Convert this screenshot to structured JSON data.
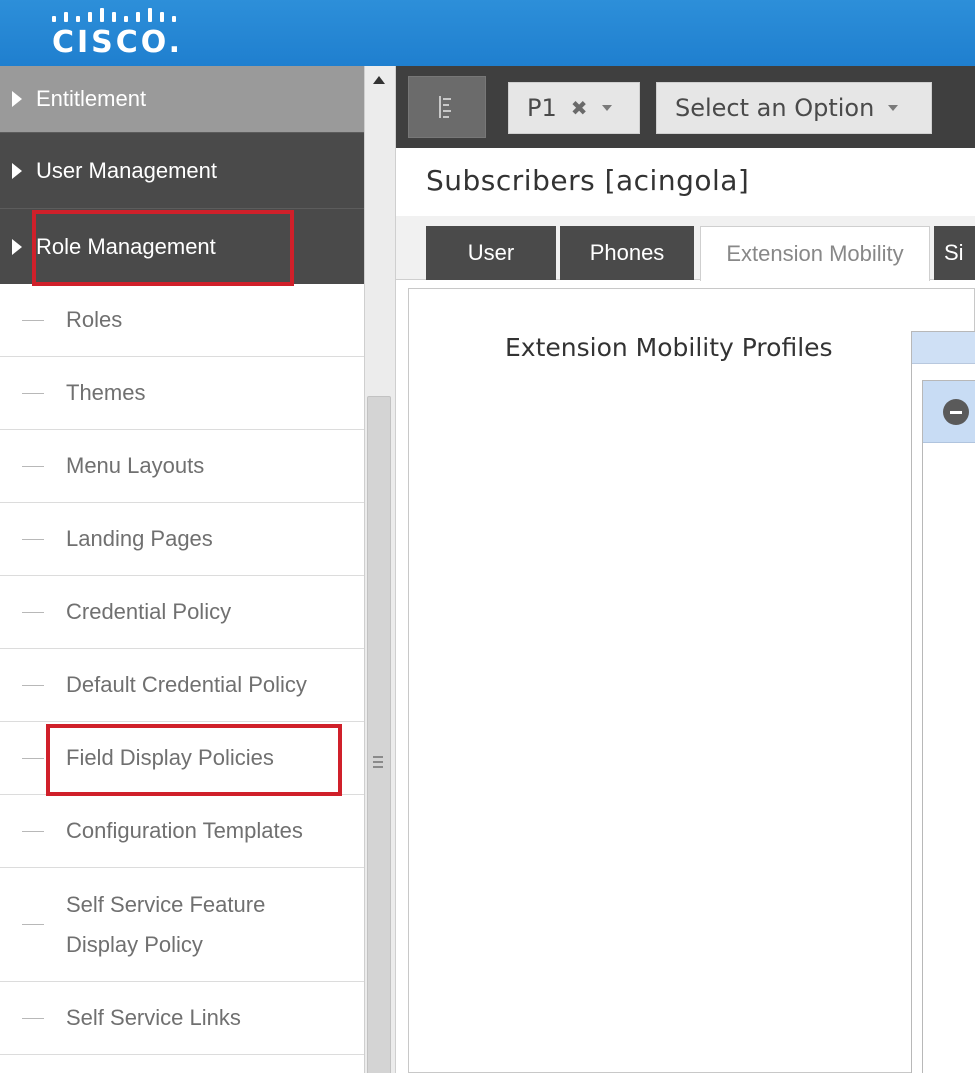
{
  "brand": {
    "logo_text": "CISCO",
    "logo_dot": ".",
    "color": "#1f7fcf"
  },
  "sidebar": {
    "top_items": [
      {
        "label": "Entitlement"
      },
      {
        "label": "User Management"
      },
      {
        "label": "Role Management"
      }
    ],
    "sub_items": [
      {
        "label": "Roles"
      },
      {
        "label": "Themes"
      },
      {
        "label": "Menu Layouts"
      },
      {
        "label": "Landing Pages"
      },
      {
        "label": "Credential Policy"
      },
      {
        "label": "Default Credential Policy"
      },
      {
        "label": "Field Display Policies"
      },
      {
        "label": "Configuration Templates"
      },
      {
        "label": "Self Service Feature Display Policy"
      },
      {
        "label": "Self Service Links"
      }
    ],
    "highlight_color": "#d0202a"
  },
  "toolbar": {
    "toggle_icon": "sidebar-toggle-icon",
    "hierarchy_select": {
      "value": "P1",
      "clear_icon": "close-icon"
    },
    "option_select": {
      "value": "Select an Option"
    }
  },
  "page": {
    "title": "Subscribers [acingola]"
  },
  "tabs": [
    {
      "label": "User"
    },
    {
      "label": "Phones"
    },
    {
      "label": "Extension Mobility"
    },
    {
      "label": "Si"
    }
  ],
  "content": {
    "profiles_label": "Extension Mobility Profiles",
    "remove_icon": "minus-circle-icon"
  }
}
